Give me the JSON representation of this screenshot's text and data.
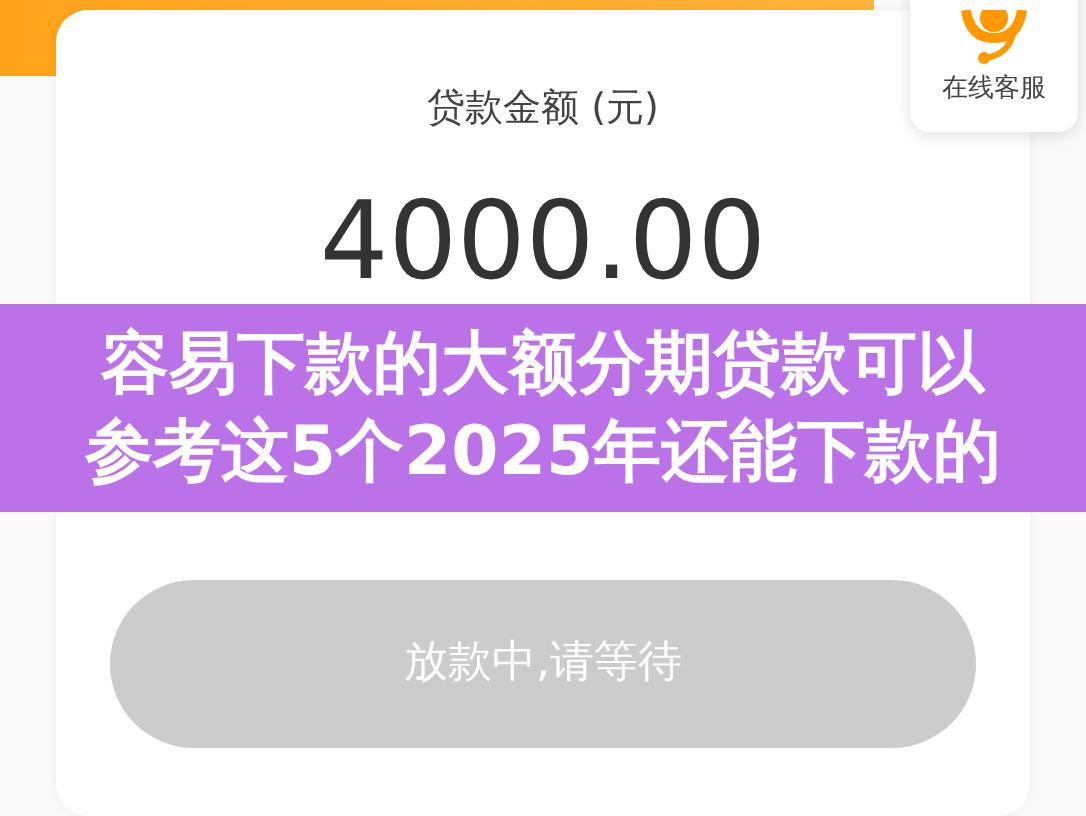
{
  "loan_card": {
    "amount_label": "贷款金额 (元)",
    "amount": "4000.00",
    "submit_button": {
      "label": "放款中,请等待",
      "disabled": true
    }
  },
  "service_button": {
    "label": "在线客服"
  },
  "overlay_caption": {
    "lines": [
      "容易下款的大额分期贷款可以",
      "参考这5个2025年还能下款的"
    ]
  }
}
